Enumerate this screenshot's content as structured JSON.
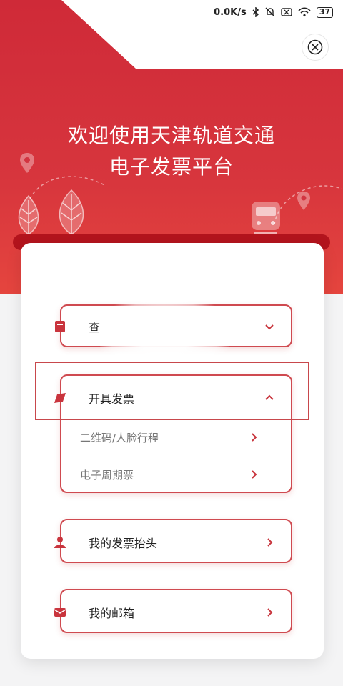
{
  "status_bar": {
    "speed": "0.0K/s",
    "battery": "37"
  },
  "hero": {
    "title_line1": "欢迎使用天津轨道交通",
    "title_line2": "电子发票平台"
  },
  "menu": {
    "query": {
      "label": "查"
    },
    "issue": {
      "label": "开具发票",
      "sub_items": [
        {
          "label": "二维码/人脸行程"
        },
        {
          "label": "电子周期票"
        }
      ]
    },
    "header": {
      "label": "我的发票抬头"
    },
    "mailbox": {
      "label": "我的邮箱"
    }
  },
  "colors": {
    "brand_red": "#cf2a38",
    "border_red": "#cf4a50"
  },
  "icons": {
    "close": "close-icon",
    "chevron_down": "chevron-down-icon",
    "chevron_up": "chevron-up-icon",
    "chevron_right": "chevron-right-icon"
  }
}
